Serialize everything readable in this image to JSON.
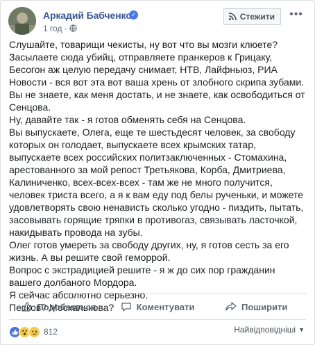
{
  "post": {
    "author": "Аркадий Бабченко",
    "timestamp": "1 год",
    "follow_label": "Стежити",
    "more_label": "•••",
    "paragraphs": [
      "Слушайте, товарищи чекисты, ну вот что вы мозги клюете? Засылаете сюда убийц, отправляете пранкеров к Грицаку, Бесогон аж целую передачу снимает, НТВ, Лайфньюз, РИА Новости - вся вот эта вот ваша хрень от злобного скрипа зубами.\nВы не знаете, как меня достать, и не знаете, как освободиться от Сенцова.",
      "Ну, давайте так - я готов обменять себя на Сенцова.\nВы выпускаете, Олега, еще те шестьдесят человек, за свободу которых он голодает, выпускаете всех крымских татар, выпускаете всех российских политзаключенных - Стомахина, арестованного за мой репост Третьякова, Корба, Дмитриева, Калиниченко, всех-всех-всех - там же не много получится, человек триста всего, а я к вам еду под белы рученьки, и можете удовлетворять свою ненависть сколько угодно - пиздить, пытать, засовывать горящие тряпки в противогаз, связывать ласточкой, накидывать провода на зубы.\nОлег готов умереть за свободу других, ну, я готов сесть за его жизнь. А вы решите свой геморрой.\nВопрос с экстрадицией решите - я ж до сих пор гражданин вашего долбаного Мордора.\nЯ сейчас абсолютно серьезно.\nПесков? Москалькова?"
    ]
  },
  "actions": {
    "like": "Подобається",
    "comment": "Коментувати",
    "share": "Поширити"
  },
  "footer": {
    "reaction_count": "812",
    "sort_label": "Найвідповідніші"
  },
  "colors": {
    "author": "#385898",
    "like_reaction": "#4e74d9",
    "emoji_reaction": "#f7c948"
  }
}
